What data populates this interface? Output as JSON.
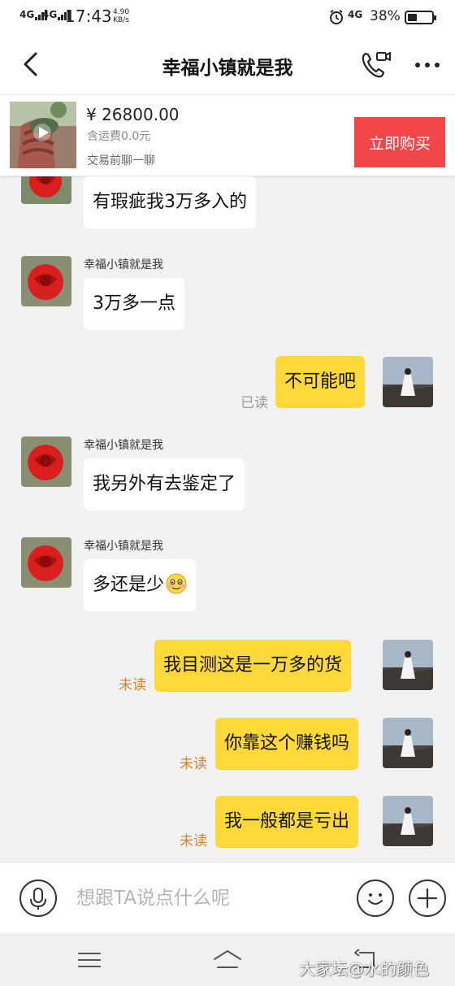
{
  "status_bar": {
    "network1": "4G",
    "network2": "4G",
    "time": "17:43",
    "speed_value": "4.90",
    "speed_unit": "KB/s",
    "network3": "4G",
    "battery": "38%",
    "battery_level": 0.38
  },
  "header": {
    "title": "幸福小镇就是我"
  },
  "product": {
    "price": "¥ 26800.00",
    "shipping": "含运费0.0元",
    "chat_hint": "交易前聊一聊",
    "buy_label": "立即购买"
  },
  "messages": [
    {
      "side": "in",
      "sender": "",
      "text": "有瑕疵我3万多入的",
      "status": ""
    },
    {
      "side": "in",
      "sender": "幸福小镇就是我",
      "text": "3万多一点",
      "status": ""
    },
    {
      "side": "out",
      "sender": "",
      "text": "不可能吧",
      "status": "已读"
    },
    {
      "side": "in",
      "sender": "幸福小镇就是我",
      "text": "我另外有去鉴定了",
      "status": ""
    },
    {
      "side": "in",
      "sender": "幸福小镇就是我",
      "text": "多还是少",
      "status": "",
      "emoji": "smile-emoji"
    },
    {
      "side": "out",
      "sender": "",
      "text": "我目测这是一万多的货",
      "status": "未读"
    },
    {
      "side": "out",
      "sender": "",
      "text": "你靠这个赚钱吗",
      "status": "未读"
    },
    {
      "side": "out",
      "sender": "",
      "text": "我一般都是亏出",
      "status": "未读"
    }
  ],
  "input": {
    "placeholder": "想跟TA说点什么呢"
  },
  "icons": {
    "back": "back-arrow-icon",
    "video": "video-call-icon",
    "more": "more-icon",
    "mic": "microphone-icon",
    "emoji": "smiley-icon",
    "plus": "plus-icon"
  },
  "watermark": "大家坛@水的颜色",
  "colors": {
    "buy_button": "#f2474a",
    "outgoing_bubble": "#ffd83a",
    "unread_text": "#d9822b"
  }
}
